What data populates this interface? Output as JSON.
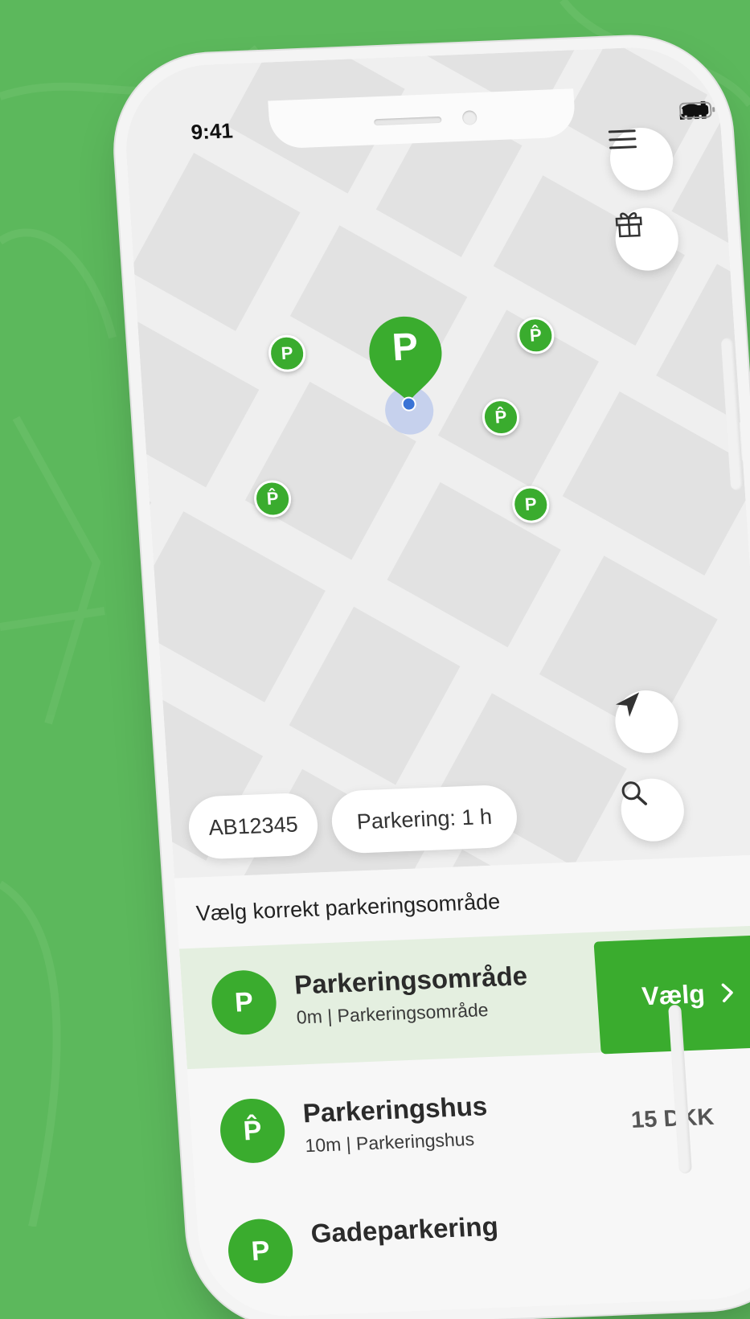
{
  "status_bar": {
    "time": "9:41"
  },
  "map": {
    "big_pin_letter": "P",
    "pins": [
      {
        "letter": "P",
        "kind": "area"
      },
      {
        "letter": "P̂",
        "kind": "garage"
      },
      {
        "letter": "P̂",
        "kind": "garage"
      },
      {
        "letter": "P",
        "kind": "area"
      },
      {
        "letter": "P̂",
        "kind": "garage"
      }
    ]
  },
  "buttons": {
    "menu": "menu-icon",
    "gift": "gift-icon",
    "locate": "navigation-arrow-icon",
    "search": "search-icon"
  },
  "chips": {
    "plate": "AB12345",
    "parking": "Parkering: 1 h"
  },
  "sheet": {
    "title": "Vælg korrekt parkeringsområde",
    "rows": [
      {
        "icon": "P",
        "name": "Parkeringsområde",
        "sub": "0m | Parkeringsområde",
        "action": "Vælg",
        "selected": true
      },
      {
        "icon": "P̂",
        "name": "Parkeringshus",
        "sub": "10m | Parkeringshus",
        "price": "15 DKK",
        "selected": false
      },
      {
        "icon": "P",
        "name": "Gadeparkering",
        "sub": ""
      }
    ]
  },
  "colors": {
    "brand": "#3aac2e",
    "background": "#5cb85c",
    "selected_row": "#e4efe0"
  }
}
